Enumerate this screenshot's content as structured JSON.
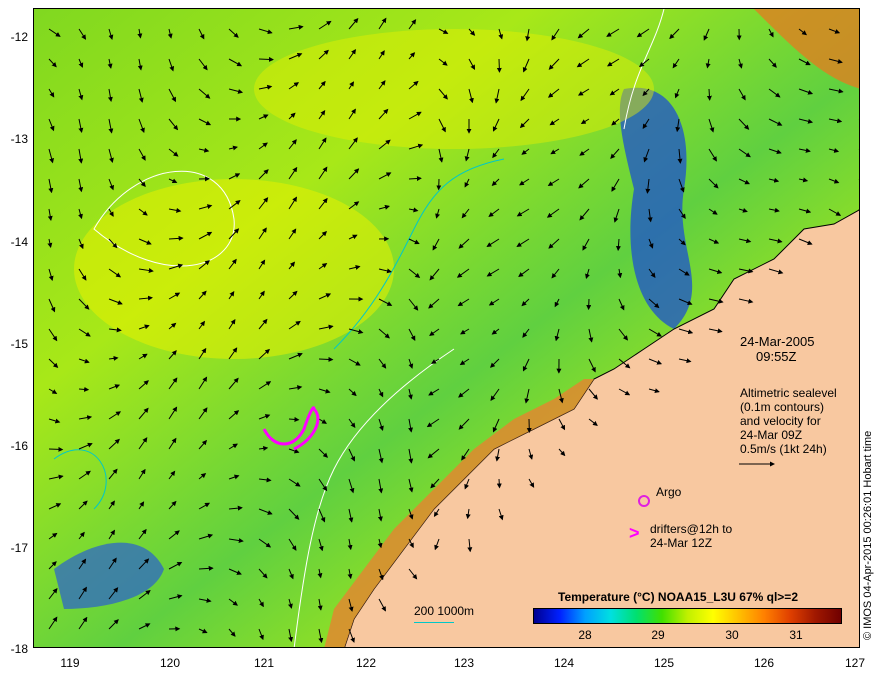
{
  "map": {
    "lat_ticks": [
      "-12",
      "-13",
      "-14",
      "-15",
      "-16",
      "-17",
      "-18"
    ],
    "lon_ticks": [
      "119",
      "120",
      "121",
      "122",
      "123",
      "124",
      "125",
      "126",
      "127"
    ],
    "lon_range": [
      118.6,
      127
    ],
    "lat_range": [
      -18,
      -11.7
    ]
  },
  "annotation": {
    "date": "24-Mar-2005",
    "time": "09:55Z",
    "line1": "Altimetric sealevel",
    "line2": "(0.1m contours)",
    "line3": "and velocity for",
    "line4": "24-Mar 09Z",
    "scale_label": "0.5m/s (1kt 24h)",
    "argo_label": "Argo",
    "drifters_line1": "drifters@12h to",
    "drifters_line2": "24-Mar 12Z",
    "argo_symbol": "o",
    "drifter_symbol": ">"
  },
  "depth_legend": "200  1000m",
  "colorbar": {
    "title": "Temperature (°C) NOAA15_L3U 67% ql>=2",
    "ticks": [
      "28",
      "29",
      "30",
      "31"
    ],
    "range": [
      27.5,
      31.7
    ]
  },
  "credit": "© IMOS 04-Apr-2015 00:26:01 Hobart time",
  "colors": {
    "land": "#f8c8a0",
    "contour_depth": "#00c8c8",
    "sealevel_contour": "#ffffff",
    "argo": "#e020e0",
    "drifter": "#ff00ff",
    "arrows": "#000000"
  }
}
